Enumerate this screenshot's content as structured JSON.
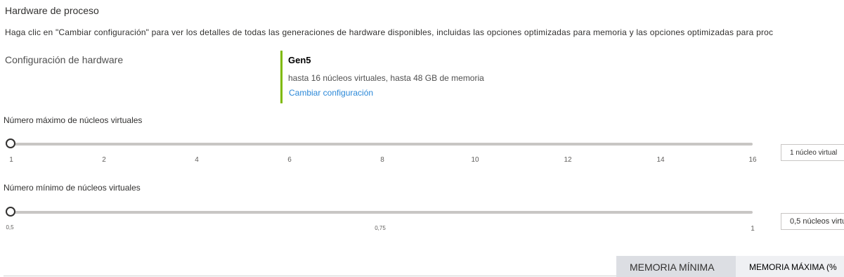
{
  "section": {
    "title": "Hardware de proceso",
    "description": "Haga clic en \"Cambiar configuración\" para ver los detalles de todas las generaciones de hardware disponibles, incluidas las opciones optimizadas para memoria y las opciones optimizadas para proc"
  },
  "hardware": {
    "label": "Configuración de hardware",
    "generation": "Gen5",
    "details": "hasta 16 núcleos virtuales, hasta 48 GB de memoria",
    "change_link": "Cambiar configuración",
    "accent_color": "#7fba00"
  },
  "max_vcores": {
    "label": "Número máximo de núcleos virtuales",
    "ticks": [
      "1",
      "2",
      "4",
      "6",
      "8",
      "10",
      "12",
      "14",
      "16"
    ],
    "value": 1,
    "value_text": "1 núcleo virtual"
  },
  "min_vcores": {
    "label": "Número mínimo de núcleos virtuales",
    "ticks": [
      "0,5",
      "0,75",
      "1"
    ],
    "value": 0.5,
    "value_text": "0,5 núcleos virtu"
  },
  "tabs": {
    "min_memory": "MEMORIA MÍNIMA",
    "max_memory": "MEMORIA MÁXIMA (%"
  }
}
